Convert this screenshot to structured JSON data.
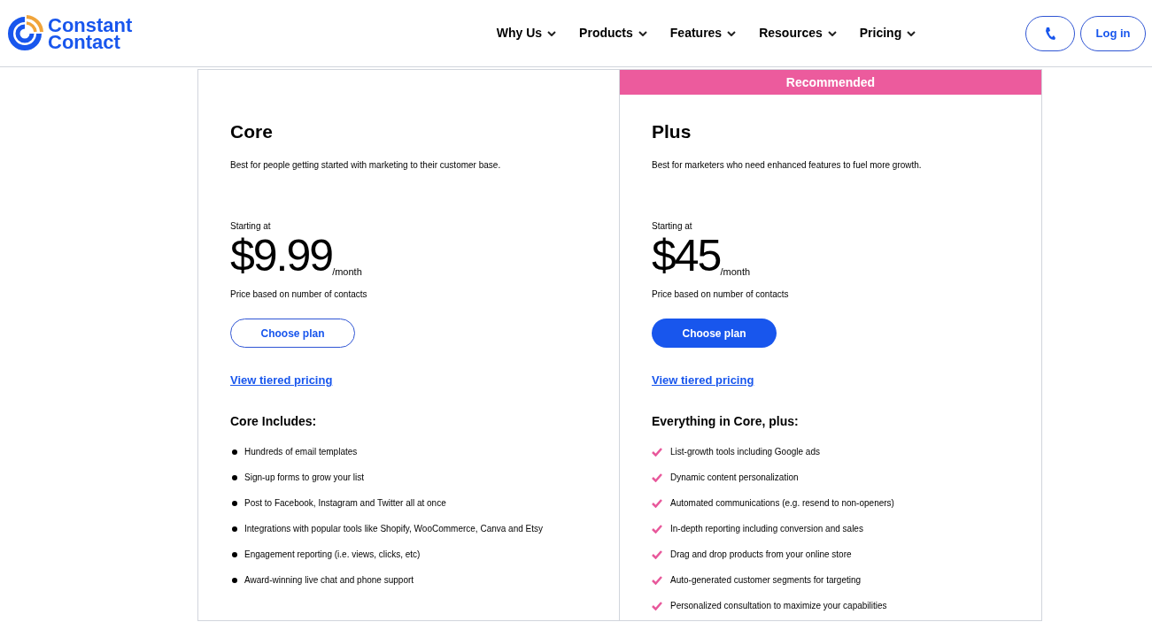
{
  "header": {
    "logo": {
      "line_1": "Constant",
      "line_2": "Contact"
    },
    "nav": [
      {
        "label": "Why Us"
      },
      {
        "label": "Products"
      },
      {
        "label": "Features"
      },
      {
        "label": "Resources"
      },
      {
        "label": "Pricing"
      }
    ],
    "login": "Log in"
  },
  "plans": [
    {
      "kind": "basic",
      "name": "Core",
      "description": "Best for people getting started with marketing to their customer base.",
      "starting": "Starting at",
      "price": "$9.99",
      "period": "/month",
      "note": "Price based on number of contacts",
      "button": "Choose plan",
      "link": "View tiered pricing",
      "features_title": "Core Includes:",
      "features": [
        "Hundreds of email templates",
        "Sign-up forms to grow your list",
        "Post to Facebook, Instagram and Twitter all at once",
        "Integrations with popular tools like Shopify, WooCommerce, Canva and Etsy",
        "Engagement reporting (i.e. views, clicks, etc)",
        "Award-winning live chat and phone support"
      ]
    },
    {
      "kind": "recommended",
      "banner": "Recommended",
      "name": "Plus",
      "description": "Best for marketers who need enhanced features to fuel more growth.",
      "starting": "Starting at",
      "price": "$45",
      "period": "/month",
      "note": "Price based on number of contacts",
      "button": "Choose plan",
      "link": "View tiered pricing",
      "features_title": "Everything in Core, plus:",
      "features": [
        "List-growth tools including Google ads",
        "Dynamic content personalization",
        "Automated communications (e.g. resend to non-openers)",
        "In-depth reporting including conversion and sales",
        "Drag and drop products from your online store",
        "Auto-generated customer segments for targeting",
        "Personalized consultation to maximize your capabilities"
      ]
    }
  ]
}
